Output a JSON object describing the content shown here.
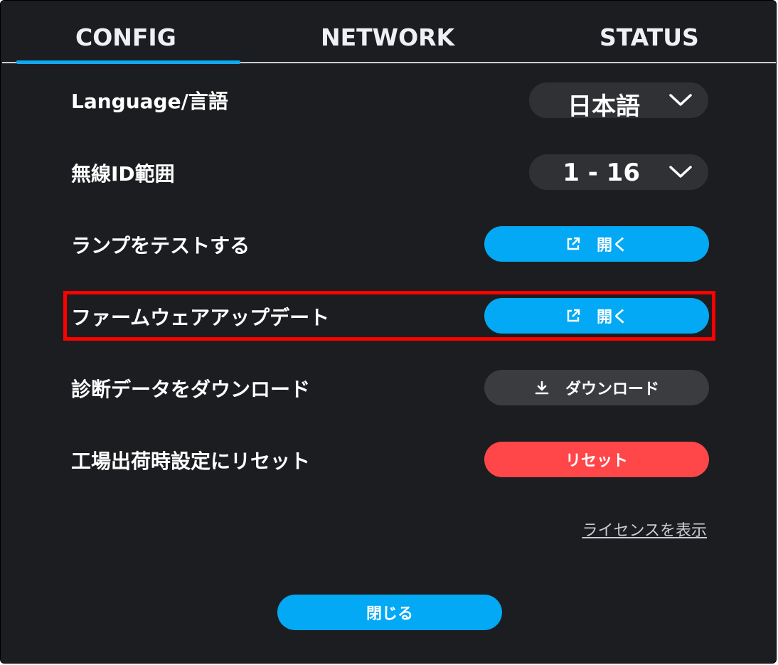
{
  "tabs": [
    {
      "label": "CONFIG",
      "active": true
    },
    {
      "label": "NETWORK",
      "active": false
    },
    {
      "label": "STATUS",
      "active": false
    }
  ],
  "settings": {
    "language": {
      "label": "Language/言語",
      "value": "日本語"
    },
    "radio_id_range": {
      "label": "無線ID範囲",
      "value": "1 - 16"
    },
    "lamp_test": {
      "label": "ランプをテストする",
      "button": "開く"
    },
    "firmware_update": {
      "label": "ファームウェアアップデート",
      "button": "開く"
    },
    "diagnostic_download": {
      "label": "診断データをダウンロード",
      "button": "ダウンロード"
    },
    "factory_reset": {
      "label": "工場出荷時設定にリセット",
      "button": "リセット"
    }
  },
  "license_link": "ライセンスを表示",
  "close_button": "閉じる",
  "colors": {
    "background": "#1c1d20",
    "accent_blue": "#03a9f4",
    "danger_red": "#ff4649",
    "control_dark": "#2f3135",
    "highlight_red": "#ff0000"
  },
  "icons": {
    "open": "external-link-icon",
    "download": "download-icon",
    "dropdown": "chevron-down-icon"
  }
}
